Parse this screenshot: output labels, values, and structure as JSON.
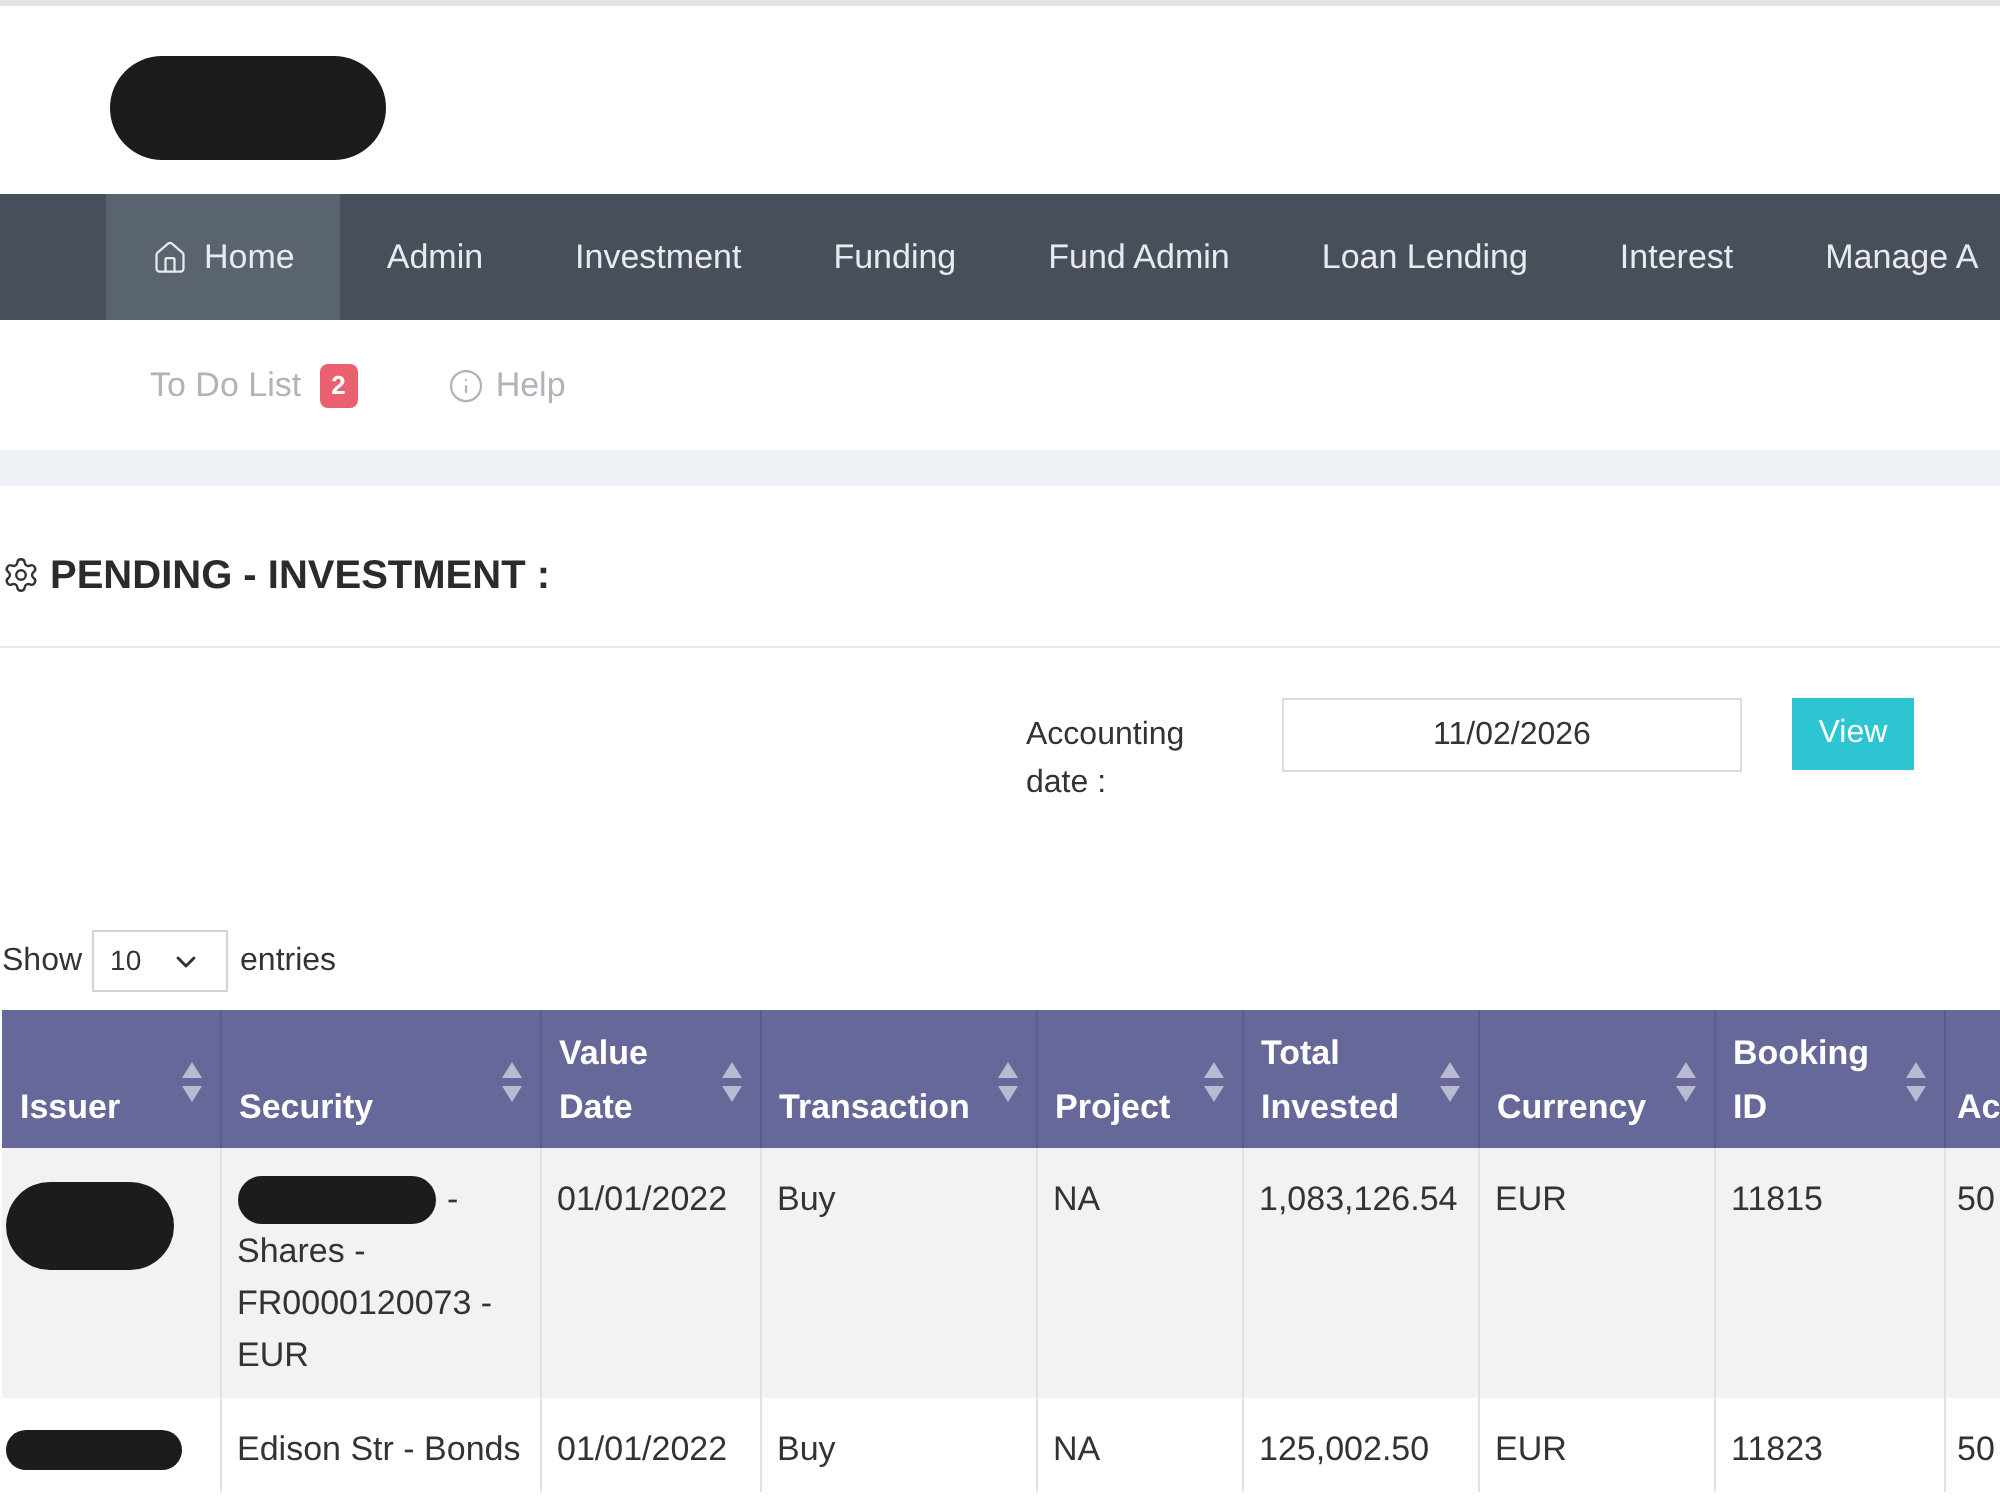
{
  "header": {
    "logo_redacted": true
  },
  "nav": {
    "items": [
      {
        "label": "Home",
        "selected": true
      },
      {
        "label": "Admin",
        "selected": false
      },
      {
        "label": "Investment",
        "selected": false
      },
      {
        "label": "Funding",
        "selected": false
      },
      {
        "label": "Fund Admin",
        "selected": false
      },
      {
        "label": "Loan Lending",
        "selected": false
      },
      {
        "label": "Interest",
        "selected": false
      },
      {
        "label": "Manage A",
        "selected": false
      }
    ]
  },
  "subnav": {
    "items": [
      {
        "kind": "counter",
        "label": "To Do List",
        "count": "2"
      },
      {
        "kind": "info",
        "label": "Help"
      }
    ]
  },
  "page": {
    "title": "PENDING - INVESTMENT :"
  },
  "filter": {
    "label": "Accounting date :",
    "date": "11/02/2026",
    "button": "View"
  },
  "table_length": {
    "prefix": "Show",
    "value": "10",
    "suffix": "entries"
  },
  "table": {
    "columns": [
      {
        "label": "Issuer",
        "sortable": true
      },
      {
        "label": "Security",
        "sortable": true
      },
      {
        "label": "Value Date",
        "sortable": true
      },
      {
        "label": "Transaction",
        "sortable": true
      },
      {
        "label": "Project",
        "sortable": true
      },
      {
        "label": "Total Invested",
        "sortable": true
      },
      {
        "label": "Currency",
        "sortable": true
      },
      {
        "label": "Booking ID",
        "sortable": true
      },
      {
        "label": "Ac",
        "sortable": false
      }
    ],
    "rows": [
      {
        "issuer": {
          "redacted": true
        },
        "security": {
          "redacted_start": true,
          "lead": "-",
          "text": "Shares - FR0000120073 - EUR"
        },
        "value_date": "01/01/2022",
        "transaction": "Buy",
        "project": "NA",
        "total_invested": "1,083,126.54",
        "currency": "EUR",
        "booking_id": "11815",
        "column_9": "50"
      },
      {
        "issuer": {
          "redacted": true
        },
        "security": {
          "redacted_start": false,
          "text": "Edison Str - Bonds"
        },
        "value_date": "01/01/2022",
        "transaction": "Buy",
        "project": "NA",
        "total_invested": "125,002.50",
        "currency": "EUR",
        "booking_id": "11823",
        "column_9": "50"
      }
    ]
  }
}
